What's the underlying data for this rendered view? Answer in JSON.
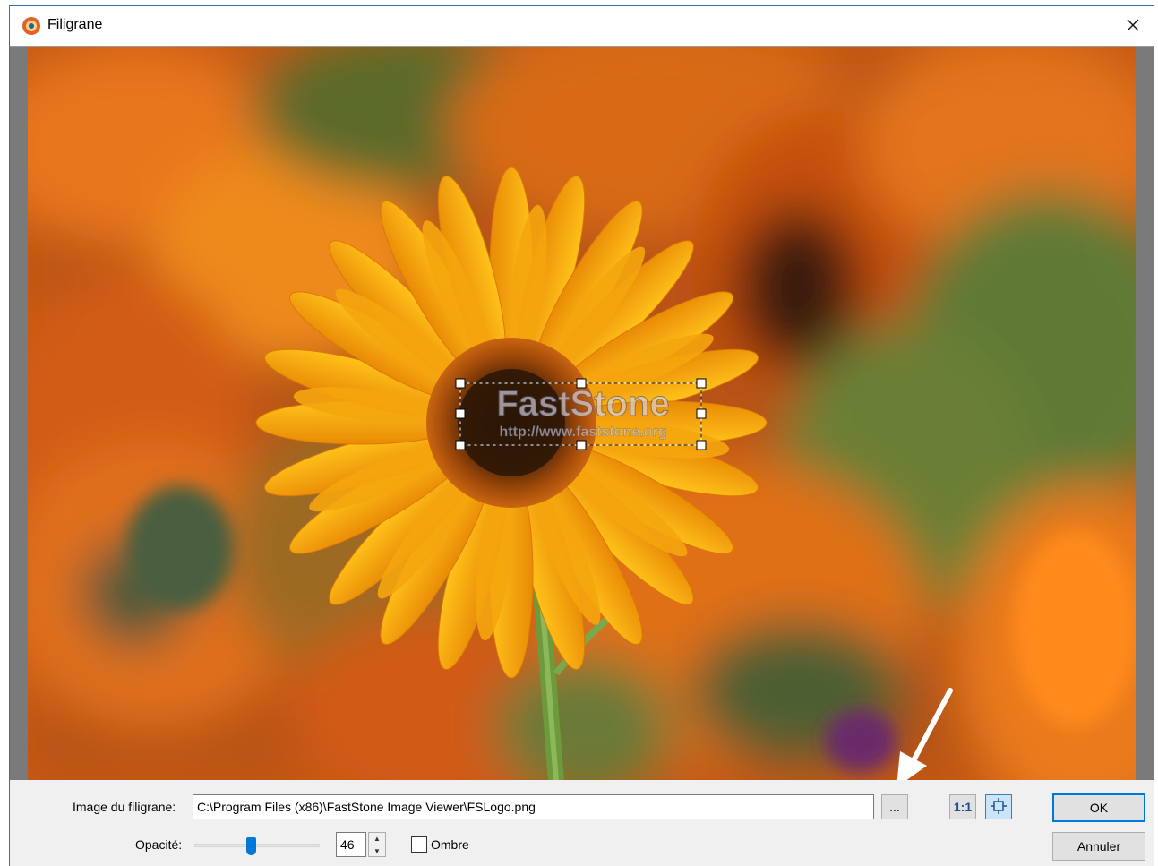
{
  "window": {
    "title": "Filigrane"
  },
  "preview": {
    "watermark_title": "FastStone",
    "watermark_url": "http://www.faststone.org"
  },
  "form": {
    "image_label": "Image du filigrane:",
    "image_path": "C:\\Program Files (x86)\\FastStone Image Viewer\\FSLogo.png",
    "browse_label": "...",
    "actual_size_label": "1:1",
    "opacity_label": "Opacité:",
    "opacity_value": "46",
    "shadow_label": "Ombre",
    "shadow_checked": false
  },
  "buttons": {
    "ok": "OK",
    "cancel": "Annuler"
  },
  "icons": {
    "app": "fs-app-icon",
    "close": "close-icon",
    "fit": "fit-to-window-icon",
    "arrow": "pointer-arrow-annotation"
  },
  "colors": {
    "accent": "#0078d7",
    "window_border": "#2f6fb5"
  }
}
